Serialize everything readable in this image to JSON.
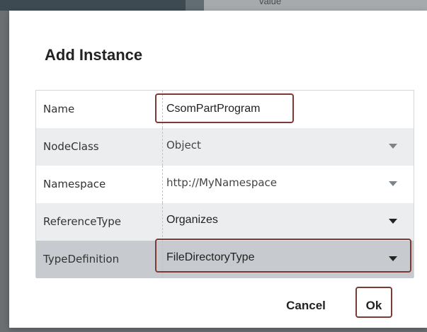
{
  "background": {
    "header_text": "value"
  },
  "dialog": {
    "title": "Add Instance",
    "rows": [
      {
        "label": "Name",
        "value": "CsomPartProgram",
        "type": "text-input"
      },
      {
        "label": "NodeClass",
        "value": "Object",
        "type": "dropdown",
        "state": "disabled"
      },
      {
        "label": "Namespace",
        "value": "http://MyNamespace",
        "type": "dropdown",
        "state": "disabled"
      },
      {
        "label": "ReferenceType",
        "value": "Organizes",
        "type": "dropdown",
        "state": "enabled"
      },
      {
        "label": "TypeDefinition",
        "value": "FileDirectoryType",
        "type": "dropdown",
        "state": "selected"
      }
    ],
    "buttons": {
      "cancel": "Cancel",
      "ok": "Ok"
    }
  },
  "colors": {
    "highlight": "#7d3a35",
    "row_shaded": "#ecedef",
    "row_selected": "#c7cace",
    "header_dark": "#3e4a52"
  },
  "icons": {
    "dropdown": "chevron-down-icon"
  }
}
